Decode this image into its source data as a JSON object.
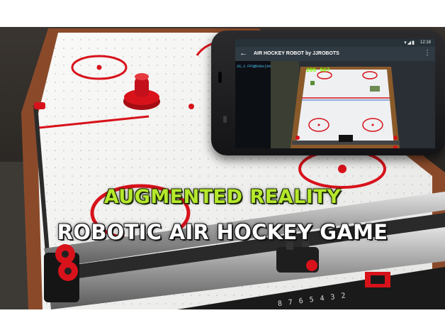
{
  "overlay": {
    "line1": "AUGMENTED REALITY",
    "line2": "ROBOTIC AIR HOCKEY  GAME"
  },
  "phone": {
    "status_time": "12:18",
    "status_icons": "▾◢▮",
    "app_title": "AIR HOCKEY ROBOT by JJROBOTS",
    "back_glyph": "←",
    "menu_glyph": "⋮",
    "cam_info": "26,3 FPS@640x(04)",
    "cam_score": "285 567"
  },
  "colors": {
    "table_surface": "#f4f4f2",
    "table_red": "#d8121b",
    "ar_text": "#b5e82c",
    "game_text": "#ffffff",
    "phone_body": "#1f1f22"
  },
  "table_scale_digits": [
    "8",
    "7",
    "6",
    "5",
    "4",
    "3",
    "2"
  ]
}
